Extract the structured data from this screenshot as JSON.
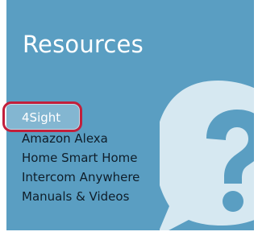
{
  "resources": {
    "title": "Resources",
    "links": [
      {
        "label": "4Sight"
      },
      {
        "label": "Amazon Alexa"
      },
      {
        "label": "Home Smart Home"
      },
      {
        "label": "Intercom Anywhere"
      },
      {
        "label": "Manuals & Videos"
      }
    ],
    "highlighted_link": "4Sight"
  },
  "colors": {
    "panel_bg": "#5a9ec2",
    "bubble": "#d6e8f1",
    "highlight_border": "#c21f3b",
    "link_text": "#0f1e2a"
  },
  "icons": {
    "bubble_icon": "help-speech-bubble-icon"
  }
}
